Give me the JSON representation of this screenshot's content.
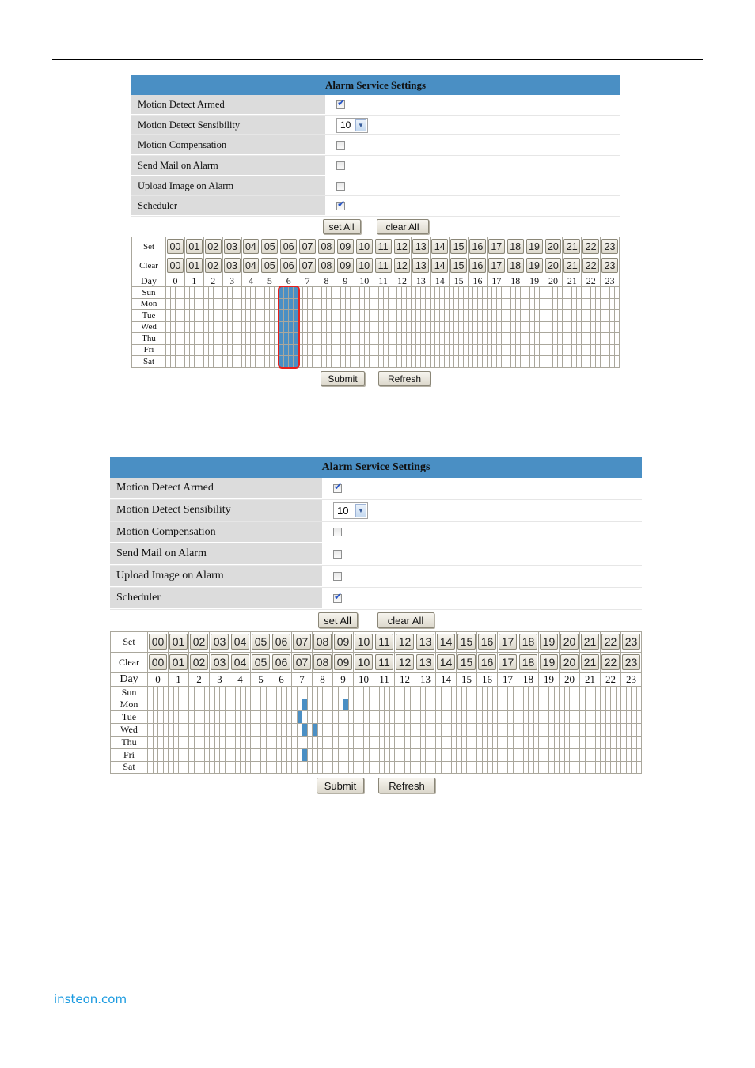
{
  "footer": {
    "link_text": "insteon.com"
  },
  "panels": [
    {
      "title": "Alarm Service Settings",
      "settings": [
        {
          "label": "Motion Detect Armed",
          "type": "checkbox",
          "checked": true
        },
        {
          "label": "Motion Detect Sensibility",
          "type": "select",
          "value": "10"
        },
        {
          "label": "Motion Compensation",
          "type": "checkbox",
          "checked": false
        },
        {
          "label": "Send Mail on Alarm",
          "type": "checkbox",
          "checked": false
        },
        {
          "label": "Upload Image on Alarm",
          "type": "checkbox",
          "checked": false
        },
        {
          "label": "Scheduler",
          "type": "checkbox",
          "checked": true
        }
      ],
      "set_all_label": "set All",
      "clear_all_label": "clear All",
      "schedule": {
        "set_row_label": "Set",
        "clear_row_label": "Clear",
        "day_header_label": "Day",
        "hour_buttons": [
          "00",
          "01",
          "02",
          "03",
          "04",
          "05",
          "06",
          "07",
          "08",
          "09",
          "10",
          "11",
          "12",
          "13",
          "14",
          "15",
          "16",
          "17",
          "18",
          "19",
          "20",
          "21",
          "22",
          "23"
        ],
        "hour_labels": [
          "0",
          "1",
          "2",
          "3",
          "4",
          "5",
          "6",
          "7",
          "8",
          "9",
          "10",
          "11",
          "12",
          "13",
          "14",
          "15",
          "16",
          "17",
          "18",
          "19",
          "20",
          "21",
          "22",
          "23"
        ],
        "days": [
          "Sun",
          "Mon",
          "Tue",
          "Wed",
          "Thu",
          "Fri",
          "Sat"
        ],
        "quarters_per_hour": 4,
        "selected": [
          {
            "day": "Sun",
            "hour": 6,
            "quarters": [
              0,
              1,
              2,
              3
            ]
          },
          {
            "day": "Mon",
            "hour": 6,
            "quarters": [
              0,
              1,
              2,
              3
            ]
          },
          {
            "day": "Tue",
            "hour": 6,
            "quarters": [
              0,
              1,
              2,
              3
            ]
          },
          {
            "day": "Wed",
            "hour": 6,
            "quarters": [
              0,
              1,
              2,
              3
            ]
          },
          {
            "day": "Thu",
            "hour": 6,
            "quarters": [
              0,
              1,
              2,
              3
            ]
          },
          {
            "day": "Fri",
            "hour": 6,
            "quarters": [
              0,
              1,
              2,
              3
            ]
          },
          {
            "day": "Sat",
            "hour": 6,
            "quarters": [
              0,
              1,
              2,
              3
            ]
          }
        ],
        "highlight_hour": 6
      },
      "submit_label": "Submit",
      "refresh_label": "Refresh",
      "colors": {
        "header": "#4a8fc4",
        "selected_cell": "#4a8fc4",
        "highlight_outline": "#e8201c"
      }
    },
    {
      "title": "Alarm Service Settings",
      "settings": [
        {
          "label": "Motion Detect Armed",
          "type": "checkbox",
          "checked": true
        },
        {
          "label": "Motion Detect Sensibility",
          "type": "select",
          "value": "10"
        },
        {
          "label": "Motion Compensation",
          "type": "checkbox",
          "checked": false
        },
        {
          "label": "Send Mail on Alarm",
          "type": "checkbox",
          "checked": false
        },
        {
          "label": "Upload Image on Alarm",
          "type": "checkbox",
          "checked": false
        },
        {
          "label": "Scheduler",
          "type": "checkbox",
          "checked": true
        }
      ],
      "set_all_label": "set All",
      "clear_all_label": "clear All",
      "schedule": {
        "set_row_label": "Set",
        "clear_row_label": "Clear",
        "day_header_label": "Day",
        "hour_buttons": [
          "00",
          "01",
          "02",
          "03",
          "04",
          "05",
          "06",
          "07",
          "08",
          "09",
          "10",
          "11",
          "12",
          "13",
          "14",
          "15",
          "16",
          "17",
          "18",
          "19",
          "20",
          "21",
          "22",
          "23"
        ],
        "hour_labels": [
          "0",
          "1",
          "2",
          "3",
          "4",
          "5",
          "6",
          "7",
          "8",
          "9",
          "10",
          "11",
          "12",
          "13",
          "14",
          "15",
          "16",
          "17",
          "18",
          "19",
          "20",
          "21",
          "22",
          "23"
        ],
        "days": [
          "Sun",
          "Mon",
          "Tue",
          "Wed",
          "Thu",
          "Fri",
          "Sat"
        ],
        "quarters_per_hour": 4,
        "selected": [
          {
            "day": "Mon",
            "hour": 7,
            "quarters": [
              2
            ]
          },
          {
            "day": "Mon",
            "hour": 9,
            "quarters": [
              2
            ]
          },
          {
            "day": "Tue",
            "hour": 7,
            "quarters": [
              1
            ]
          },
          {
            "day": "Wed",
            "hour": 7,
            "quarters": [
              2
            ]
          },
          {
            "day": "Wed",
            "hour": 8,
            "quarters": [
              0
            ]
          },
          {
            "day": "Fri",
            "hour": 7,
            "quarters": [
              2
            ]
          }
        ],
        "highlight_hour": null
      },
      "submit_label": "Submit",
      "refresh_label": "Refresh",
      "colors": {
        "header": "#4a8fc4",
        "selected_cell": "#4a8fc4"
      }
    }
  ]
}
